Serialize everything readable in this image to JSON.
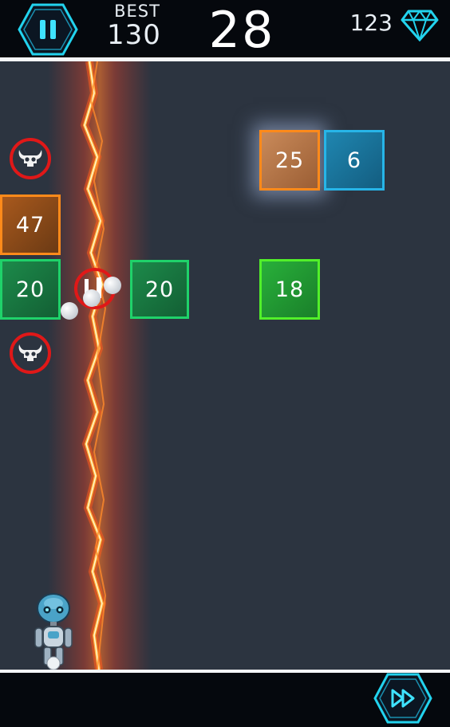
{
  "hud": {
    "best_label": "BEST",
    "best_value": "130",
    "score": "28",
    "gems": "123",
    "accent_color": "#22d3ee"
  },
  "blocks": [
    {
      "value": "25",
      "color": "orange",
      "glow": true
    },
    {
      "value": "6",
      "color": "blue"
    },
    {
      "value": "47",
      "color": "orange"
    },
    {
      "value": "20",
      "color": "green"
    },
    {
      "value": "20",
      "color": "green"
    },
    {
      "value": "18",
      "color": "lime"
    }
  ],
  "tokens": {
    "skull": {
      "icon": "horned-skull-icon",
      "ring_color": "#e01818"
    },
    "ball_splitter": {
      "icon": "ball-splitter-icon",
      "ring_color": "#e01818"
    }
  },
  "icons": {
    "pause": "pause-icon",
    "gem": "diamond-icon",
    "fast_forward": "fast-forward-icon",
    "player": "robot-icon"
  }
}
